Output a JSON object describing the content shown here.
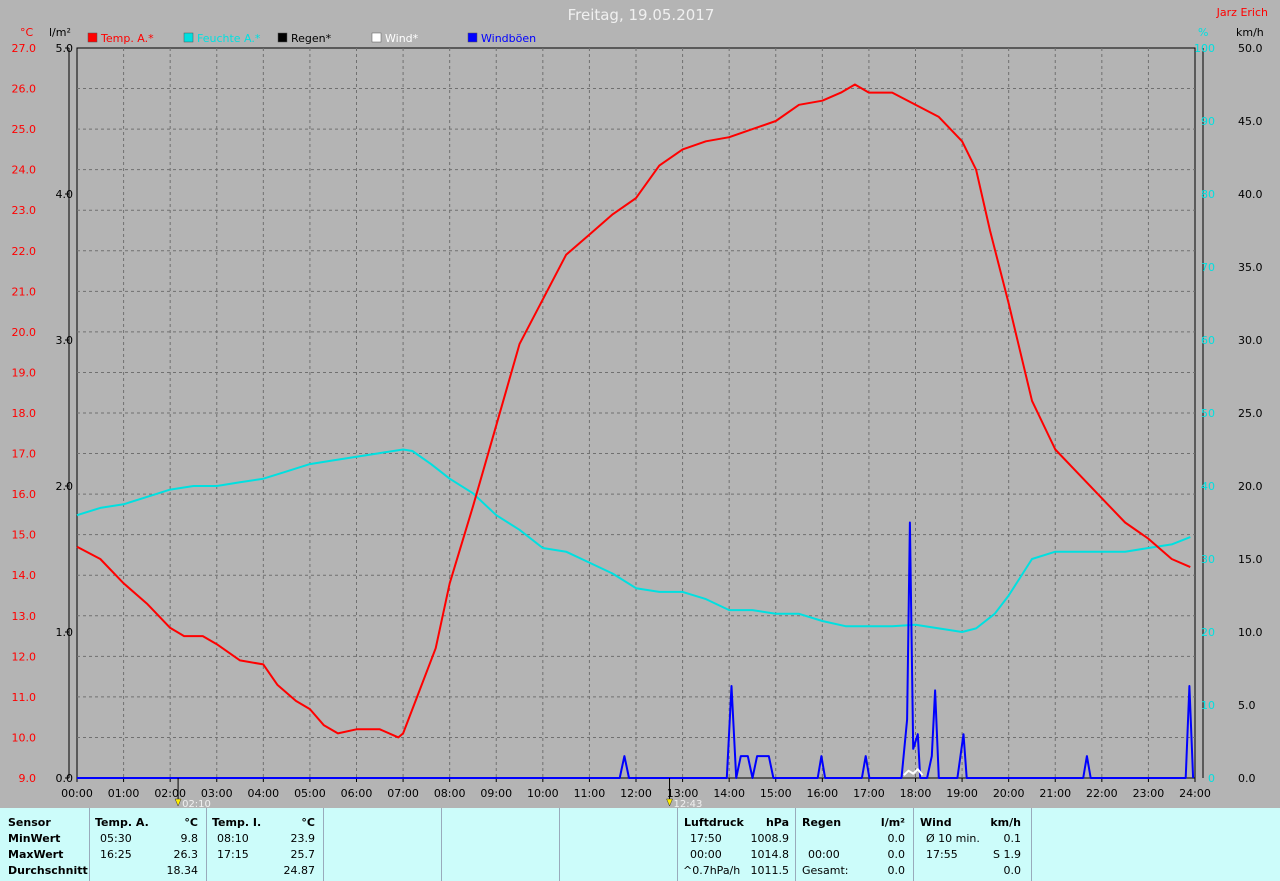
{
  "title": "Freitag, 19.05.2017",
  "author": "Jarz Erich",
  "axis_units": {
    "left_outer": "°C",
    "left_inner": "l/m²",
    "right_inner": "%",
    "right_outer": "km/h"
  },
  "colors": {
    "bg": "#b4b4b4",
    "plot_bg": "#b4b4b4",
    "temp": "#ff0000",
    "humidity": "#00e0e0",
    "rain": "#000000",
    "wind": "#ffffff",
    "gust": "#0000ff",
    "panel_bg": "#ccfcfa",
    "title": "#f0f0f0"
  },
  "legend": [
    {
      "label": "Temp. A.*",
      "color": "#ff0000"
    },
    {
      "label": "Feuchte A.*",
      "color": "#00e0e0"
    },
    {
      "label": "Regen*",
      "color": "#000000"
    },
    {
      "label": "Wind*",
      "color": "#ffffff"
    },
    {
      "label": "Windböen",
      "color": "#0000ff"
    }
  ],
  "markers": [
    {
      "time": "02:10",
      "x_hour": 2.17
    },
    {
      "time": "12:43",
      "x_hour": 12.72
    }
  ],
  "chart_data": {
    "type": "line",
    "x_ticks": [
      "00:00",
      "01:00",
      "02:00",
      "03:00",
      "04:00",
      "05:00",
      "06:00",
      "07:00",
      "08:00",
      "09:00",
      "10:00",
      "11:00",
      "12:00",
      "13:00",
      "14:00",
      "15:00",
      "16:00",
      "17:00",
      "18:00",
      "19:00",
      "20:00",
      "21:00",
      "22:00",
      "23:00",
      "24:00"
    ],
    "xlim": [
      0,
      24
    ],
    "axes": {
      "temperature": {
        "range": [
          9.0,
          27.0
        ],
        "ticks": [
          "9.0",
          "10.0",
          "11.0",
          "12.0",
          "13.0",
          "14.0",
          "15.0",
          "16.0",
          "17.0",
          "18.0",
          "19.0",
          "20.0",
          "21.0",
          "22.0",
          "23.0",
          "24.0",
          "25.0",
          "26.0",
          "27.0"
        ]
      },
      "rain": {
        "range": [
          0.0,
          5.0
        ],
        "ticks": [
          "0.0",
          "1.0",
          "2.0",
          "3.0",
          "4.0",
          "5.0"
        ]
      },
      "humidity": {
        "range": [
          0,
          100
        ],
        "ticks": [
          "0",
          "10",
          "20",
          "30",
          "40",
          "50",
          "60",
          "70",
          "80",
          "90",
          "100"
        ]
      },
      "wind": {
        "range": [
          0.0,
          50.0
        ],
        "ticks": [
          "0.0",
          "5.0",
          "10.0",
          "15.0",
          "20.0",
          "25.0",
          "30.0",
          "35.0",
          "40.0",
          "45.0",
          "50.0"
        ]
      }
    },
    "series": [
      {
        "name": "Temp. A.*",
        "axis": "temperature",
        "points": [
          [
            0,
            14.7
          ],
          [
            0.5,
            14.4
          ],
          [
            1,
            13.8
          ],
          [
            1.5,
            13.3
          ],
          [
            2,
            12.7
          ],
          [
            2.3,
            12.5
          ],
          [
            2.7,
            12.5
          ],
          [
            3,
            12.3
          ],
          [
            3.5,
            11.9
          ],
          [
            4,
            11.8
          ],
          [
            4.3,
            11.3
          ],
          [
            4.7,
            10.9
          ],
          [
            5,
            10.7
          ],
          [
            5.3,
            10.3
          ],
          [
            5.6,
            10.1
          ],
          [
            6,
            10.2
          ],
          [
            6.5,
            10.2
          ],
          [
            6.9,
            10.0
          ],
          [
            7,
            10.1
          ],
          [
            7.3,
            11.0
          ],
          [
            7.7,
            12.2
          ],
          [
            8,
            13.8
          ],
          [
            8.5,
            15.7
          ],
          [
            9,
            17.7
          ],
          [
            9.5,
            19.7
          ],
          [
            10,
            20.8
          ],
          [
            10.5,
            21.9
          ],
          [
            11,
            22.4
          ],
          [
            11.5,
            22.9
          ],
          [
            12,
            23.3
          ],
          [
            12.5,
            24.1
          ],
          [
            13,
            24.5
          ],
          [
            13.5,
            24.7
          ],
          [
            14,
            24.8
          ],
          [
            14.5,
            25.0
          ],
          [
            15,
            25.2
          ],
          [
            15.5,
            25.6
          ],
          [
            16,
            25.7
          ],
          [
            16.4,
            25.9
          ],
          [
            16.7,
            26.1
          ],
          [
            17,
            25.9
          ],
          [
            17.5,
            25.9
          ],
          [
            18,
            25.6
          ],
          [
            18.5,
            25.3
          ],
          [
            19,
            24.7
          ],
          [
            19.3,
            24.0
          ],
          [
            19.6,
            22.5
          ],
          [
            20,
            20.7
          ],
          [
            20.5,
            18.3
          ],
          [
            21,
            17.1
          ],
          [
            21.5,
            16.5
          ],
          [
            22,
            15.9
          ],
          [
            22.5,
            15.3
          ],
          [
            23,
            14.9
          ],
          [
            23.5,
            14.4
          ],
          [
            23.9,
            14.2
          ]
        ]
      },
      {
        "name": "Feuchte A.*",
        "axis": "humidity",
        "points": [
          [
            0,
            36
          ],
          [
            0.5,
            37
          ],
          [
            1,
            37.5
          ],
          [
            1.5,
            38.5
          ],
          [
            2,
            39.5
          ],
          [
            2.5,
            40
          ],
          [
            3,
            40
          ],
          [
            3.5,
            40.5
          ],
          [
            4,
            41
          ],
          [
            4.5,
            42
          ],
          [
            5,
            43
          ],
          [
            5.5,
            43.5
          ],
          [
            6,
            44
          ],
          [
            6.5,
            44.5
          ],
          [
            7,
            45
          ],
          [
            7.2,
            44.8
          ],
          [
            7.6,
            43
          ],
          [
            8,
            41
          ],
          [
            8.5,
            39
          ],
          [
            9,
            36
          ],
          [
            9.5,
            34
          ],
          [
            10,
            31.5
          ],
          [
            10.5,
            31
          ],
          [
            11,
            29.5
          ],
          [
            11.5,
            28
          ],
          [
            12,
            26
          ],
          [
            12.5,
            25.5
          ],
          [
            13,
            25.5
          ],
          [
            13.5,
            24.5
          ],
          [
            14,
            23
          ],
          [
            14.5,
            23
          ],
          [
            15,
            22.5
          ],
          [
            15.5,
            22.5
          ],
          [
            16,
            21.5
          ],
          [
            16.5,
            20.8
          ],
          [
            17,
            20.8
          ],
          [
            17.5,
            20.8
          ],
          [
            18,
            21
          ],
          [
            18.5,
            20.5
          ],
          [
            19,
            20
          ],
          [
            19.3,
            20.5
          ],
          [
            19.7,
            22.5
          ],
          [
            20,
            25
          ],
          [
            20.5,
            30
          ],
          [
            21,
            31
          ],
          [
            21.5,
            31
          ],
          [
            22,
            31
          ],
          [
            22.5,
            31
          ],
          [
            23,
            31.5
          ],
          [
            23.5,
            32
          ],
          [
            23.9,
            33
          ]
        ]
      },
      {
        "name": "Windböen",
        "axis": "wind",
        "points": [
          [
            0,
            0
          ],
          [
            11.65,
            0
          ],
          [
            11.75,
            1.5
          ],
          [
            11.85,
            0
          ],
          [
            13.95,
            0
          ],
          [
            14.05,
            6.3
          ],
          [
            14.15,
            0
          ],
          [
            14.25,
            1.5
          ],
          [
            14.4,
            1.5
          ],
          [
            14.5,
            0
          ],
          [
            14.6,
            1.5
          ],
          [
            14.85,
            1.5
          ],
          [
            14.95,
            0
          ],
          [
            15.9,
            0
          ],
          [
            15.98,
            1.5
          ],
          [
            16.06,
            0
          ],
          [
            16.85,
            0
          ],
          [
            16.93,
            1.5
          ],
          [
            17.01,
            0
          ],
          [
            17.7,
            0
          ],
          [
            17.82,
            4
          ],
          [
            17.88,
            17.5
          ],
          [
            17.95,
            2
          ],
          [
            18.05,
            3
          ],
          [
            18.1,
            0
          ],
          [
            18.25,
            0
          ],
          [
            18.35,
            1.5
          ],
          [
            18.42,
            6
          ],
          [
            18.5,
            0
          ],
          [
            18.9,
            0
          ],
          [
            19.03,
            3
          ],
          [
            19.1,
            0
          ],
          [
            21.6,
            0
          ],
          [
            21.68,
            1.5
          ],
          [
            21.76,
            0
          ],
          [
            23.8,
            0
          ],
          [
            23.88,
            6.3
          ],
          [
            23.96,
            0
          ]
        ]
      },
      {
        "name": "Wind*",
        "axis": "wind",
        "points": [
          [
            17.75,
            0.2
          ],
          [
            17.85,
            0.5
          ],
          [
            17.95,
            0.3
          ],
          [
            18.05,
            0.6
          ],
          [
            18.15,
            0.2
          ]
        ]
      }
    ]
  },
  "stats": {
    "sensor": {
      "header": "Sensor",
      "rows": [
        "MinWert",
        "MaxWert",
        "Durchschnitt"
      ]
    },
    "temp_a": {
      "header": "Temp. A.",
      "unit": "°C",
      "min_time": "05:30",
      "min": "9.8",
      "max_time": "16:25",
      "max": "26.3",
      "avg": "18.34"
    },
    "temp_i": {
      "header": "Temp. I.",
      "unit": "°C",
      "min_time": "08:10",
      "min": "23.9",
      "max_time": "17:15",
      "max": "25.7",
      "avg": "24.87"
    },
    "pressure": {
      "header": "Luftdruck",
      "unit": "hPa",
      "min_time": "17:50",
      "min": "1008.9",
      "max_time": "00:00",
      "max": "1014.8",
      "trend_label": "^0.7hPa/h",
      "avg": "1011.5"
    },
    "rain": {
      "header": "Regen",
      "unit": "l/m²",
      "r1": "0.0",
      "r2_time": "00:00",
      "r2": "0.0",
      "total_label": "Gesamt:",
      "total": "0.0"
    },
    "wind": {
      "header": "Wind",
      "unit": "km/h",
      "avg_label": "Ø 10 min.",
      "avg": "0.1",
      "max_time": "17:55",
      "max": "S 1.9",
      "r3": "0.0"
    }
  }
}
